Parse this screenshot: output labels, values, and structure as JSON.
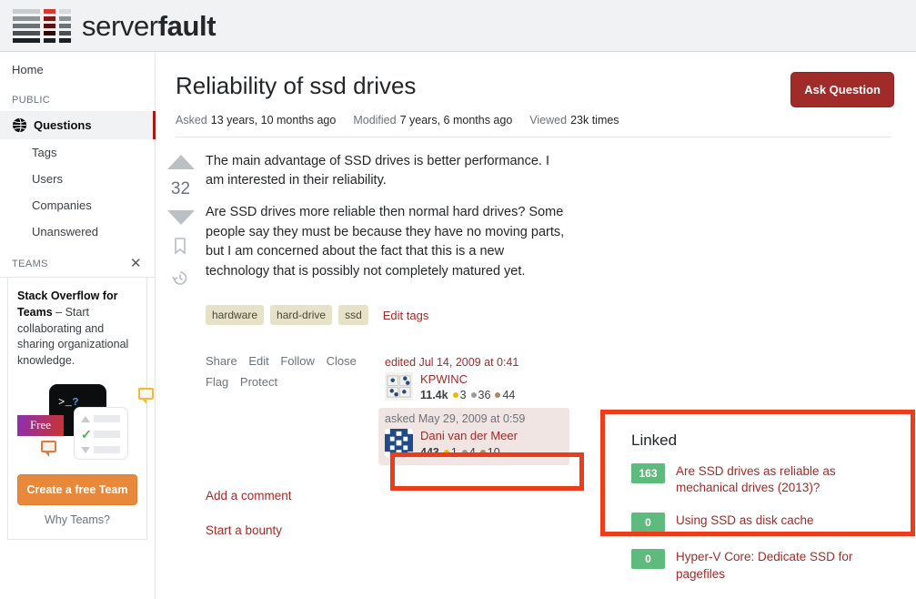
{
  "site": {
    "logo_text_thin": "server",
    "logo_text_bold": "fault"
  },
  "sidebar": {
    "home_label": "Home",
    "public_label": "PUBLIC",
    "items": [
      {
        "label": "Questions",
        "icon": "globe-icon",
        "active": true
      },
      {
        "label": "Tags",
        "active": false
      },
      {
        "label": "Users",
        "active": false
      },
      {
        "label": "Companies",
        "active": false
      },
      {
        "label": "Unanswered",
        "active": false
      }
    ],
    "teams_label": "TEAMS",
    "teams_close_icon": "close-icon",
    "promo": {
      "title": "Stack Overflow for Teams",
      "body": " – Start collaborating and sharing organizational knowledge.",
      "terminal_text": ">_",
      "terminal_question": "?",
      "free_badge": "Free",
      "cta_label": "Create a free Team",
      "why_label": "Why Teams?"
    }
  },
  "question": {
    "title": "Reliability of ssd drives",
    "ask_button": "Ask Question",
    "meta": {
      "asked_label": "Asked",
      "asked_value": "13 years, 10 months ago",
      "modified_label": "Modified",
      "modified_value": "7 years, 6 months ago",
      "viewed_label": "Viewed",
      "viewed_value": "23k times"
    },
    "vote_count": "32",
    "body_paragraphs": [
      "The main advantage of SSD drives is better performance. I am interested in their reliability.",
      "Are SSD drives more reliable then normal hard drives? Some people say they must be because they have no moving parts, but I am concerned about the fact that this is a new technology that is possibly not completely matured yet."
    ],
    "tags": [
      "hardware",
      "hard-drive",
      "ssd"
    ],
    "edit_tags_label": "Edit tags",
    "actions": [
      "Share",
      "Edit",
      "Follow",
      "Close",
      "Flag",
      "Protect"
    ],
    "editor": {
      "stamp": "edited Jul 14, 2009 at 0:41",
      "name": "KPWINC",
      "reputation": "11.4k",
      "gold": "3",
      "silver": "36",
      "bronze": "44"
    },
    "asker": {
      "stamp": "asked May 29, 2009 at 0:59",
      "name": "Dani van der Meer",
      "reputation": "443",
      "gold": "1",
      "silver": "4",
      "bronze": "10"
    },
    "add_comment_label": "Add a comment",
    "start_bounty_label": "Start a bounty"
  },
  "linked": {
    "heading": "Linked",
    "items": [
      {
        "score": "163",
        "title": "Are SSD drives as reliable as mechanical drives (2013)?"
      },
      {
        "score": "0",
        "title": "Using SSD as disk cache"
      },
      {
        "score": "0",
        "title": "Hyper-V Core: Dedicate SSD for pagefiles"
      }
    ]
  },
  "colors": {
    "brand_red": "#a12b28",
    "annotation_red": "#ec3c1c",
    "tag_bg": "#e6e2c8",
    "score_green": "#5eba7d",
    "teams_orange": "#e8883b"
  }
}
